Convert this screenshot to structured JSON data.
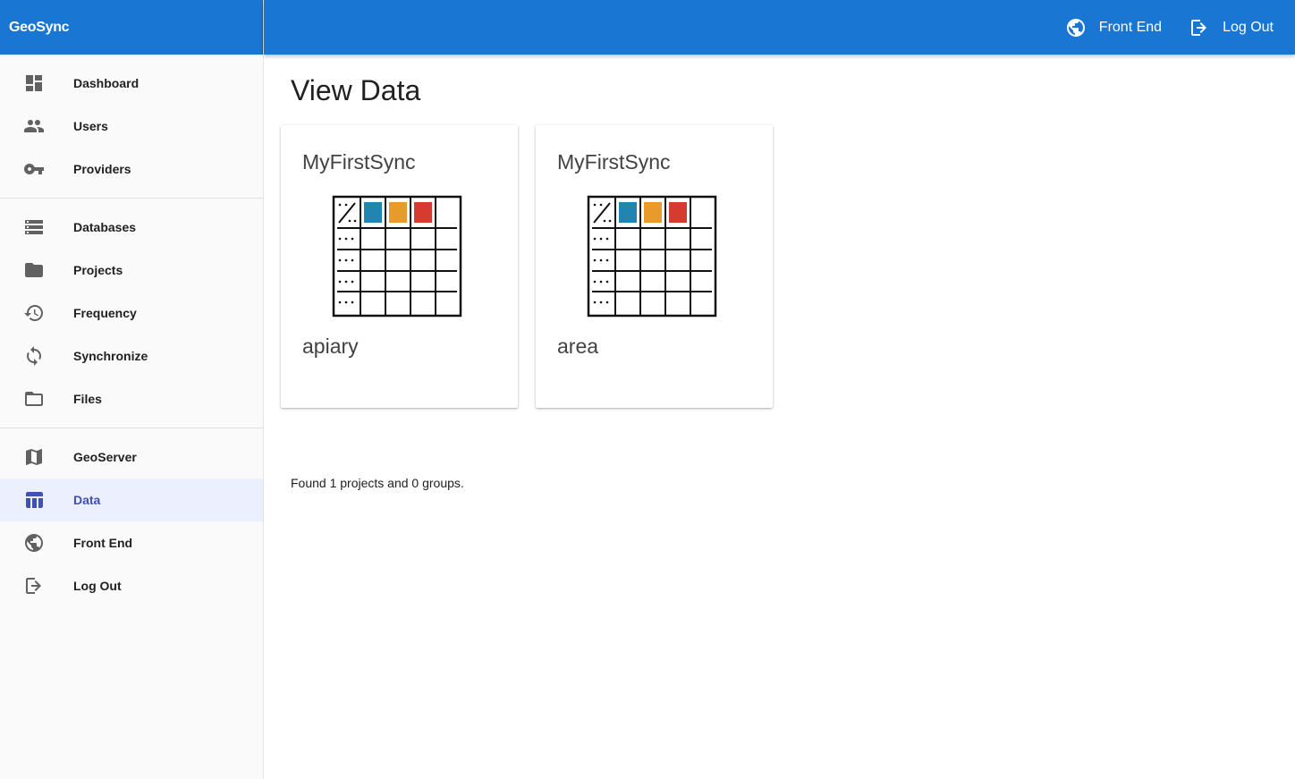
{
  "brand": "GeoSync",
  "topbar": {
    "front_end": "Front End",
    "log_out": "Log Out"
  },
  "sidebar": {
    "group1": [
      {
        "label": "Dashboard",
        "icon": "dashboard-icon"
      },
      {
        "label": "Users",
        "icon": "users-icon"
      },
      {
        "label": "Providers",
        "icon": "key-icon"
      }
    ],
    "group2": [
      {
        "label": "Databases",
        "icon": "database-icon"
      },
      {
        "label": "Projects",
        "icon": "folder-icon"
      },
      {
        "label": "Frequency",
        "icon": "history-icon"
      },
      {
        "label": "Synchronize",
        "icon": "sync-icon"
      },
      {
        "label": "Files",
        "icon": "folder-outline-icon"
      }
    ],
    "group3": [
      {
        "label": "GeoServer",
        "icon": "map-icon"
      },
      {
        "label": "Data",
        "icon": "table-icon",
        "active": true
      },
      {
        "label": "Front End",
        "icon": "globe-icon"
      },
      {
        "label": "Log Out",
        "icon": "logout-icon"
      }
    ]
  },
  "main": {
    "title": "View Data",
    "cards": [
      {
        "title": "MyFirstSync",
        "subtitle": "apiary",
        "icon": "data-table-icon"
      },
      {
        "title": "MyFirstSync",
        "subtitle": "area",
        "icon": "data-table-icon"
      }
    ],
    "found_text": "Found 1 projects and 0 groups."
  },
  "colors": {
    "primary": "#1976d2",
    "active_bg": "#eceffe",
    "active_fg": "#3f51b5",
    "tile_blue": "#2284b0",
    "tile_orange": "#e89b2b",
    "tile_red": "#d63b30"
  }
}
